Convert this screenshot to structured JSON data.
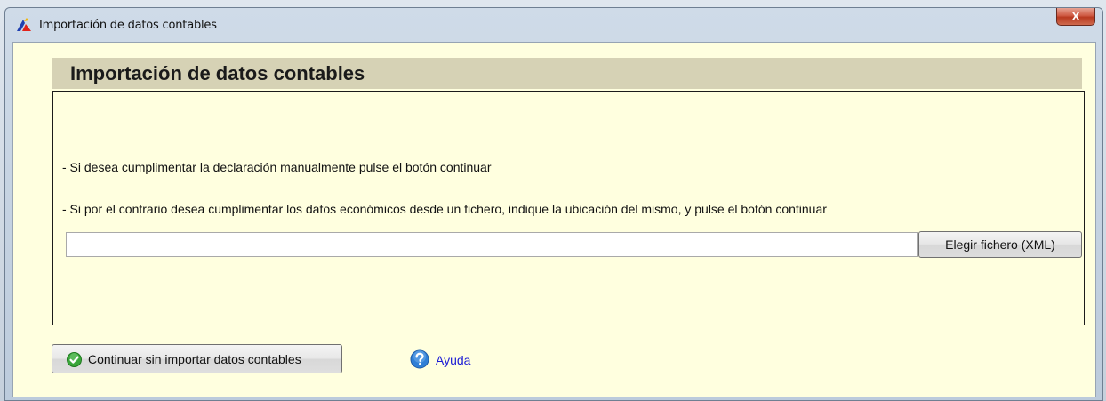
{
  "window": {
    "title": "Importación de datos contables",
    "close_label": "X",
    "icon": "app-logo-icon"
  },
  "header": {
    "title": "Importación de datos contables"
  },
  "instructions": {
    "manual": "- Si desea cumplimentar la declaración manualmente pulse el botón continuar",
    "file": "- Si por el contrario desea cumplimentar los datos económicos desde un fichero, indique la ubicación del mismo, y pulse el botón continuar"
  },
  "file_picker": {
    "value": "",
    "button_label": "Elegir fichero (XML)"
  },
  "actions": {
    "continue_label_before": "Continu",
    "continue_label_mnemonic": "a",
    "continue_label_after": "r sin importar datos contables",
    "continue_icon": "green-check-icon",
    "help_label": "Ayuda",
    "help_icon": "help-question-icon"
  },
  "colors": {
    "client_bg": "#ffffdf",
    "header_band": "#d6d2b5",
    "help_link": "#1b1bd6",
    "close_button": "#c94b33"
  }
}
